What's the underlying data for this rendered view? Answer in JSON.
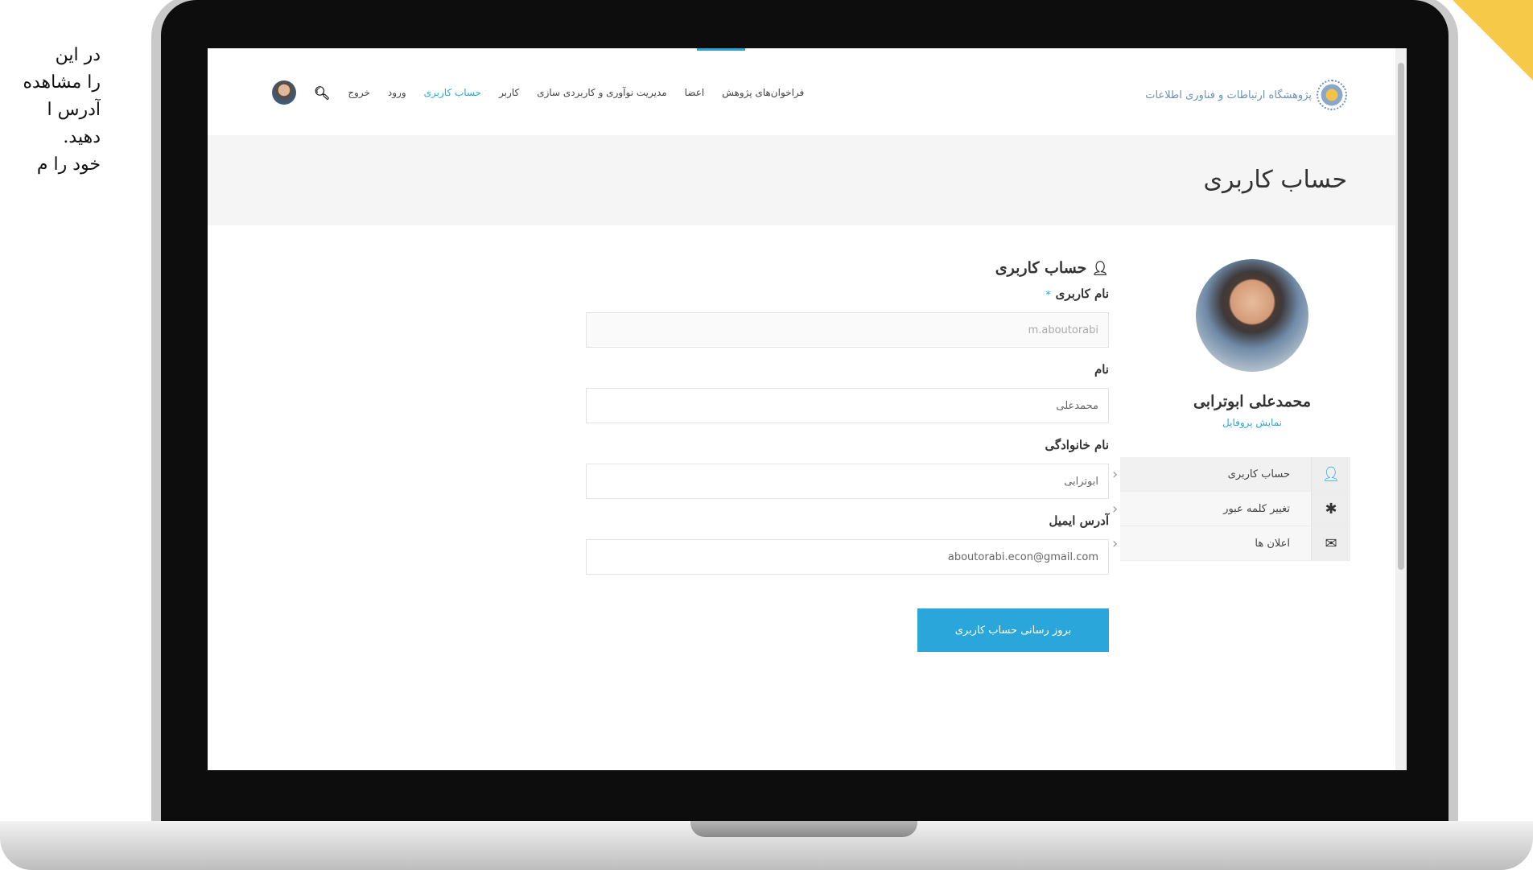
{
  "slide_text": [
    "در این",
    "را مشاهده",
    "آدرس ا",
    "دهید.",
    "خود را م"
  ],
  "nav": {
    "logo_text": "پژوهشگاه ارتباطات و فناوری اطلاعات",
    "links": [
      "فراخوان‌های پژوهش",
      "اعضا",
      "مدیریت نوآوری و کاربردی سازی",
      "کاربر",
      "حساب کاربری",
      "ورود",
      "خروج"
    ],
    "active_index": 4
  },
  "page_title": "حساب کاربری",
  "profile": {
    "name": "محمدعلی ابوترابی",
    "link": "نمایش پروفایل"
  },
  "side_menu": [
    {
      "label": "حساب کاربری",
      "icon": "user-icon"
    },
    {
      "label": "تغییر کلمه عبور",
      "icon": "asterisk-icon"
    },
    {
      "label": "اعلان ها",
      "icon": "envelope-icon"
    }
  ],
  "form": {
    "title": "حساب کاربری",
    "username_label": "نام کاربری",
    "username_required": "*",
    "username_value": "m.aboutorabi",
    "firstname_label": "نام",
    "firstname_value": "محمدعلی",
    "lastname_label": "نام خانوادگی",
    "lastname_value": "ابوترابی",
    "email_label": "آدرس ایمیل",
    "email_value": "aboutorabi.econ@gmail.com",
    "submit_label": "بروز رسانی حساب کاربری"
  },
  "colors": {
    "accent": "#2aa6da",
    "band": "#f5f5f5",
    "corner": "#f7c948"
  }
}
